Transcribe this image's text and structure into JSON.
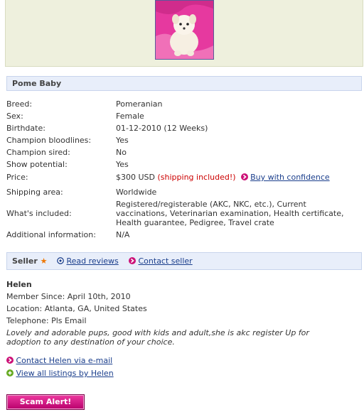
{
  "listing": {
    "title": "Pome Baby",
    "photo_alt": "puppy-photo"
  },
  "details": [
    {
      "label": "Breed:",
      "value": "Pomeranian"
    },
    {
      "label": "Sex:",
      "value": "Female"
    },
    {
      "label": "Birthdate:",
      "value": "01-12-2010 (12 Weeks)"
    },
    {
      "label": "Champion bloodlines:",
      "value": "Yes"
    },
    {
      "label": "Champion sired:",
      "value": "No"
    },
    {
      "label": "Show potential:",
      "value": "Yes"
    }
  ],
  "price": {
    "label": "Price:",
    "amount": "$300 USD",
    "shipping_note": "(shipping included!)",
    "buy_link": "Buy with confidence"
  },
  "shipping_area": {
    "label": "Shipping area:",
    "value": "Worldwide"
  },
  "included": {
    "label": "What's included:",
    "value": "Registered/registerable (AKC, NKC, etc.), Current vaccinations, Veterinarian examination, Health certificate, Health guarantee, Pedigree, Travel crate"
  },
  "additional": {
    "label": "Additional information:",
    "value": "N/A"
  },
  "seller_bar": {
    "title": "Seller",
    "star": "★",
    "reviews_link": "Read reviews",
    "contact_link": "Contact seller"
  },
  "seller": {
    "name": "Helen",
    "member_since": "Member Since: April 10th, 2010",
    "location": "Location: Atlanta, GA, United States",
    "telephone": "Telephone: Pls Email",
    "about": "Lovely and adorable pups, good with kids and adult,she is akc register Up for adoption to any destination of your choice.",
    "contact_email_link": "Contact Helen via e-mail",
    "listings_link": "View all listings by Helen"
  },
  "scam_button": "Scam Alert!",
  "colors": {
    "accent_pink": "#cc1177",
    "link_blue": "#1a3e8c",
    "price_red": "#cc0000",
    "star_orange": "#ee7700",
    "green_bullet": "#66aa22"
  }
}
